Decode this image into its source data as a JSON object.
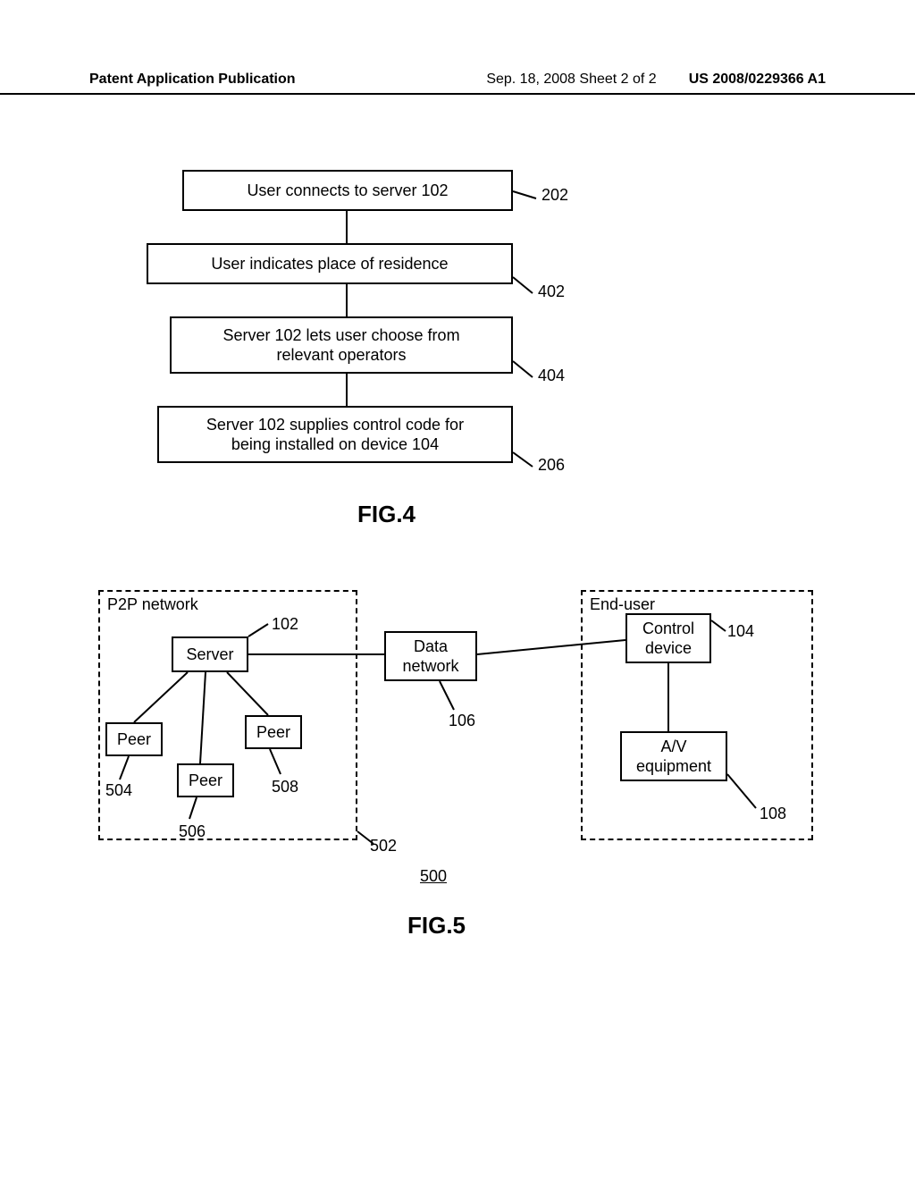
{
  "header": {
    "left": "Patent Application Publication",
    "mid": "Sep. 18, 2008  Sheet 2 of 2",
    "right": "US 2008/0229366 A1"
  },
  "fig4": {
    "title": "FIG.4",
    "steps": [
      {
        "text": "User connects to server 102",
        "ref": "202"
      },
      {
        "text": "User indicates place of residence",
        "ref": "402"
      },
      {
        "text": "Server 102 lets user choose from\nrelevant operators",
        "ref": "404"
      },
      {
        "text": "Server 102 supplies control code for\nbeing installed on device 104",
        "ref": "206"
      }
    ]
  },
  "fig5": {
    "title": "FIG.5",
    "system_ref": "500",
    "p2p_label": "P2P network",
    "p2p_ref": "502",
    "enduser_label": "End-user",
    "server": {
      "label": "Server",
      "ref": "102"
    },
    "data_network": {
      "label": "Data\nnetwork",
      "ref": "106"
    },
    "control_device": {
      "label": "Control\ndevice",
      "ref": "104"
    },
    "av_equipment": {
      "label": "A/V\nequipment",
      "ref": "108"
    },
    "peer_a": {
      "label": "Peer",
      "ref": "504"
    },
    "peer_b": {
      "label": "Peer",
      "ref": "506"
    },
    "peer_c": {
      "label": "Peer",
      "ref": "508"
    }
  }
}
